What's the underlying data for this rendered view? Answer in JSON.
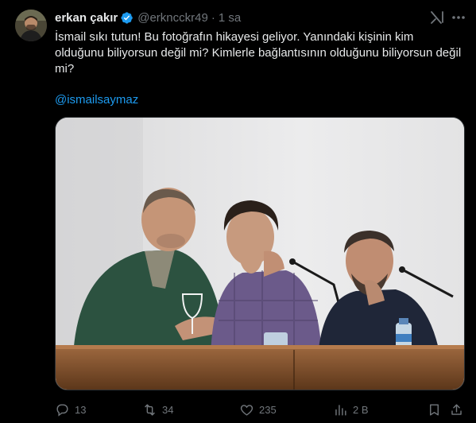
{
  "tweet": {
    "author_name": "erkan çakır",
    "handle": "@erkncckr49",
    "separator": "·",
    "time": "1 sa",
    "text": "İsmail sıkı tutun! Bu fotoğrafın hikayesi geliyor. Yanındaki kişinin kim olduğunu biliyorsun değil mi? Kimlerle bağlantısının olduğunu biliyorsun değil mi?",
    "mention": "@ismailsaymaz"
  },
  "actions": {
    "replies": "13",
    "retweets": "34",
    "likes": "235",
    "views": "2 B"
  },
  "colors": {
    "background": "#000000",
    "text": "#e7e9ea",
    "secondary": "#71767b",
    "accent": "#1d9bf0"
  },
  "icons": {
    "verified": "verified-badge-icon",
    "grok": "grok-icon",
    "more": "more-options-icon",
    "reply": "reply-icon",
    "retweet": "retweet-icon",
    "like": "like-icon",
    "views": "views-icon",
    "bookmark": "bookmark-icon",
    "share": "share-icon"
  }
}
